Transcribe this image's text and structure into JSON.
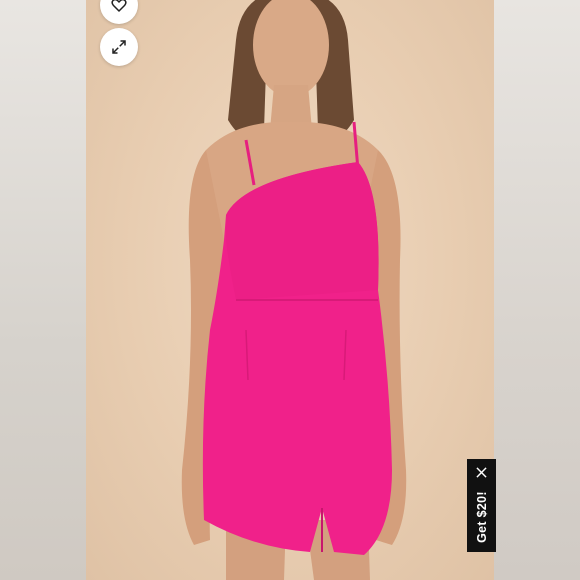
{
  "viewer": {
    "like_button": {
      "icon": "heart-outline-icon"
    },
    "expand_button": {
      "icon": "expand-arrows-icon"
    }
  },
  "photo": {
    "dress_color": "#f0218a",
    "backdrop_color": "#ecd3ba"
  },
  "promo": {
    "label": "Get $20!",
    "close_icon": "close-icon"
  }
}
